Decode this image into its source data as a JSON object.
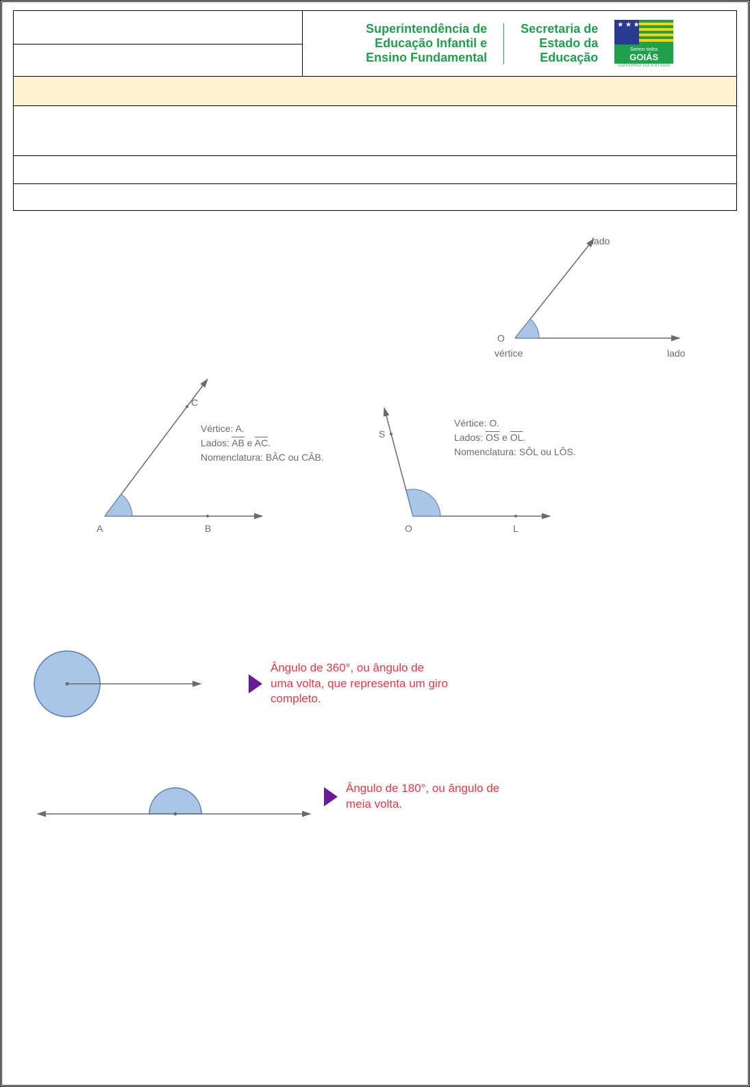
{
  "header": {
    "logo1_line1": "Superintendência de",
    "logo1_line2": "Educação Infantil e",
    "logo1_line3": "Ensino Fundamental",
    "logo2_line1": "Secretaria de",
    "logo2_line2": "Estado da",
    "logo2_line3": "Educação",
    "badge_small": "Somos todos",
    "badge_main": "GOIÁS",
    "badge_sub": "GOVERNO DO ESTADO"
  },
  "fig1": {
    "label_side_top": "lado",
    "label_side_right": "lado",
    "label_vertex_letter": "O",
    "label_vertex_word": "vértice"
  },
  "angleA": {
    "pt_vertex": "A",
    "pt_b": "B",
    "pt_c": "C",
    "line1": "Vértice: A.",
    "line2": "Lados: AB e AC.",
    "line3": "Nomenclatura: BÂC ou CÂB."
  },
  "angleO": {
    "pt_vertex": "O",
    "pt_l": "L",
    "pt_s": "S",
    "line1": "Vértice: O.",
    "line2": "Lados: OS e OL.",
    "line3": "Nomenclatura: SÔL ou LÔS."
  },
  "turns": {
    "full": "Ângulo de 360°, ou ângulo de uma volta, que representa um giro completo.",
    "half": "Ângulo de 180°, ou ângulo de meia volta."
  }
}
